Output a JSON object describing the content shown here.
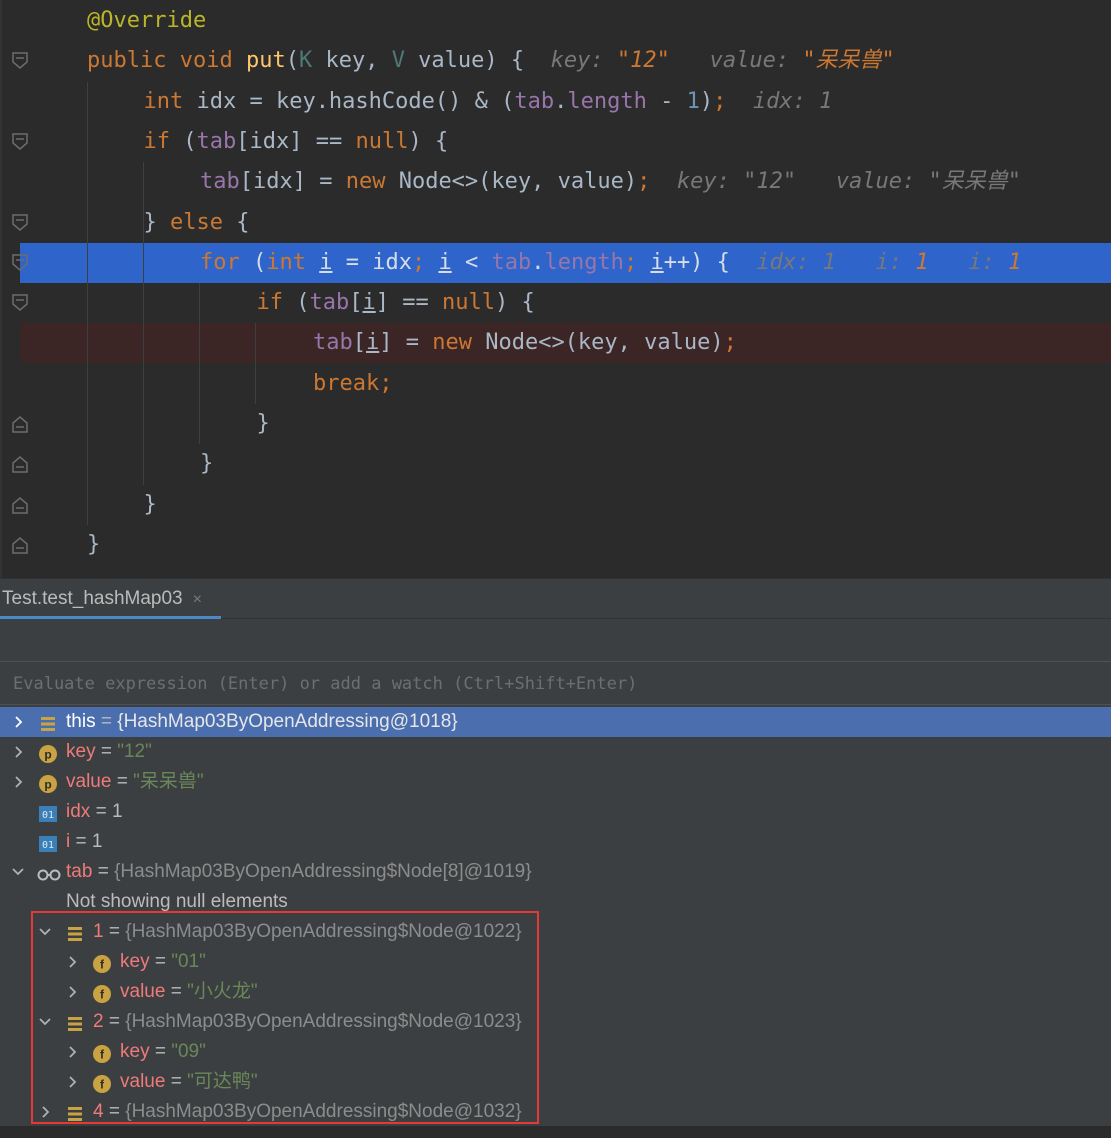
{
  "editor": {
    "lines": [
      {
        "parts": [
          [
            "ann",
            "@Override"
          ]
        ]
      },
      {
        "parts": [
          [
            "k",
            "public "
          ],
          [
            "k",
            "void "
          ],
          [
            "fn",
            "put"
          ],
          [
            "p",
            "("
          ],
          [
            "tp",
            "K"
          ],
          [
            "p",
            " key, "
          ],
          [
            "tp",
            "V"
          ],
          [
            "p",
            " value) {  "
          ],
          [
            "hint",
            "key: "
          ],
          [
            "hint-val",
            "\"12\""
          ],
          [
            "hint",
            "   value: "
          ],
          [
            "hint-val",
            "\"呆呆兽\""
          ]
        ]
      },
      {
        "parts": [
          [
            "k",
            "int "
          ],
          [
            "p",
            "idx = key.hashCode() & ("
          ],
          [
            "fd",
            "tab"
          ],
          [
            "p",
            "."
          ],
          [
            "fd",
            "length"
          ],
          [
            "p",
            " - "
          ],
          [
            "nm",
            "1"
          ],
          [
            "p",
            ")"
          ],
          [
            "k",
            ";"
          ],
          [
            "hint",
            "  idx: 1"
          ]
        ]
      },
      {
        "parts": [
          [
            "k",
            "if "
          ],
          [
            "p",
            "("
          ],
          [
            "fd",
            "tab"
          ],
          [
            "p",
            "[idx] == "
          ],
          [
            "k",
            "null"
          ],
          [
            "p",
            ") {"
          ]
        ]
      },
      {
        "parts": [
          [
            "fd",
            "tab"
          ],
          [
            "p",
            "[idx] = "
          ],
          [
            "k",
            "new "
          ],
          [
            "p",
            "Node<>(key, value)"
          ],
          [
            "k",
            ";"
          ],
          [
            "hint",
            "  key: "
          ],
          [
            "hint-plain",
            "\"12\""
          ],
          [
            "hint",
            "   value: "
          ],
          [
            "hint-plain",
            "\"呆呆兽\""
          ]
        ]
      },
      {
        "parts": [
          [
            "p",
            "} "
          ],
          [
            "k",
            "else "
          ],
          [
            "p",
            "{"
          ]
        ]
      },
      {
        "parts": [
          [
            "k",
            "for "
          ],
          [
            "p",
            "("
          ],
          [
            "k",
            "int "
          ],
          [
            "u",
            "i"
          ],
          [
            "p",
            " = idx"
          ],
          [
            "k",
            "; "
          ],
          [
            "u",
            "i"
          ],
          [
            "p",
            " < "
          ],
          [
            "fd",
            "tab"
          ],
          [
            "p",
            "."
          ],
          [
            "fd",
            "length"
          ],
          [
            "k",
            "; "
          ],
          [
            "u",
            "i"
          ],
          [
            "p",
            "++) {  "
          ],
          [
            "hint",
            "idx: 1   "
          ],
          [
            "hint",
            "i: "
          ],
          [
            "hint-val",
            "1"
          ],
          [
            "hint",
            "   i: "
          ],
          [
            "hint-val",
            "1"
          ]
        ]
      },
      {
        "parts": [
          [
            "k",
            "if "
          ],
          [
            "p",
            "("
          ],
          [
            "fd",
            "tab"
          ],
          [
            "p",
            "["
          ],
          [
            "u",
            "i"
          ],
          [
            "p",
            "] == "
          ],
          [
            "k",
            "null"
          ],
          [
            "p",
            ") {"
          ]
        ]
      },
      {
        "parts": [
          [
            "fd",
            "tab"
          ],
          [
            "p",
            "["
          ],
          [
            "u",
            "i"
          ],
          [
            "p",
            "] = "
          ],
          [
            "k",
            "new "
          ],
          [
            "p",
            "Node<>(key, value)"
          ],
          [
            "k",
            ";"
          ]
        ]
      },
      {
        "parts": [
          [
            "k",
            "break;"
          ]
        ]
      },
      {
        "parts": [
          [
            "p",
            "}"
          ]
        ]
      },
      {
        "parts": [
          [
            "p",
            "}"
          ]
        ]
      },
      {
        "parts": [
          [
            "p",
            "}"
          ]
        ]
      },
      {
        "parts": [
          [
            "p",
            "}"
          ]
        ]
      }
    ]
  },
  "debug": {
    "tab_label": "Test.test_hashMap03",
    "tab_close": "×",
    "eval_placeholder": "Evaluate expression (Enter) or add a watch (Ctrl+Shift+Enter)",
    "not_showing": "Not showing null elements",
    "vars": [
      {
        "name": "this",
        "value": "{HashMap03ByOpenAddressing@1018}",
        "kind": "obj",
        "icon": "object-icon"
      },
      {
        "name": "key",
        "value": "\"12\"",
        "kind": "str",
        "icon": "parameter-icon"
      },
      {
        "name": "value",
        "value": "\"呆呆兽\"",
        "kind": "str",
        "icon": "parameter-icon"
      },
      {
        "name": "idx",
        "value": "1",
        "kind": "num",
        "icon": "primitive-icon"
      },
      {
        "name": "i",
        "value": "1",
        "kind": "num",
        "icon": "primitive-icon"
      },
      {
        "name": "tab",
        "value": "{HashMap03ByOpenAddressing$Node[8]@1019}",
        "kind": "obj",
        "icon": "watch-icon"
      },
      {
        "name": "1",
        "value": "{HashMap03ByOpenAddressing$Node@1022}",
        "kind": "obj",
        "icon": "object-icon"
      },
      {
        "name": "key",
        "value": "\"01\"",
        "kind": "str",
        "icon": "field-icon"
      },
      {
        "name": "value",
        "value": "\"小火龙\"",
        "kind": "str",
        "icon": "field-icon"
      },
      {
        "name": "2",
        "value": "{HashMap03ByOpenAddressing$Node@1023}",
        "kind": "obj",
        "icon": "object-icon"
      },
      {
        "name": "key",
        "value": "\"09\"",
        "kind": "str",
        "icon": "field-icon"
      },
      {
        "name": "value",
        "value": "\"可达鸭\"",
        "kind": "str",
        "icon": "field-icon"
      },
      {
        "name": "4",
        "value": "{HashMap03ByOpenAddressing$Node@1032}",
        "kind": "obj",
        "icon": "object-icon"
      }
    ],
    "p_letter": "p",
    "f_letter": "f",
    "prim_text": "01",
    "eq": " = "
  },
  "colors": {
    "selection": "#4b6eaf",
    "current_line": "#2f65ca",
    "breakpoint_line": "#3b2525",
    "highlight_box": "#e53935"
  }
}
